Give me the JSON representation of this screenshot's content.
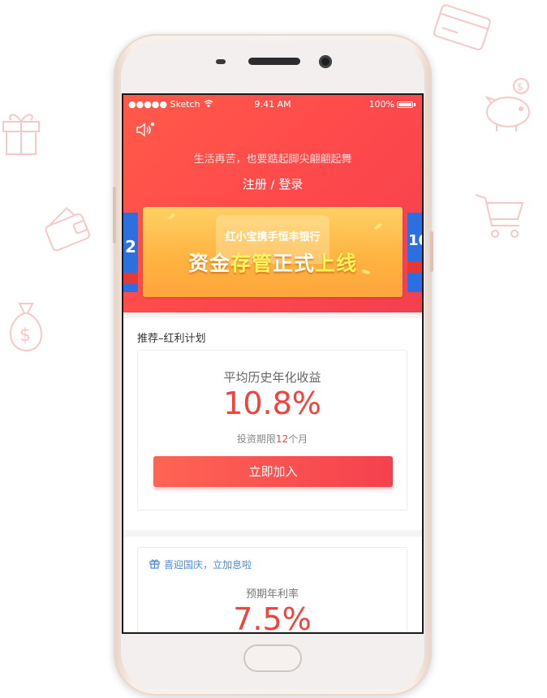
{
  "status_bar": {
    "carrier": "●●●●● Sketch",
    "time": "9:41 AM",
    "battery": "100%"
  },
  "hero": {
    "slogan": "生活再苦，也要踮起脚尖翩翩起舞",
    "login_label": "注册 / 登录"
  },
  "banner": {
    "subtitle": "红小宝携手恒丰银行",
    "title_part1": "资金",
    "title_part2": "存管",
    "title_part3": "正式",
    "title_part4": "上线",
    "left_peek_text": "2",
    "right_peek_text": "10"
  },
  "recommend": {
    "section_title": "推荐–红利计划",
    "avg_label": "平均历史年化收益",
    "rate": "10.8%",
    "term_prefix": "投资期限",
    "term_value": "12",
    "term_suffix": "个月",
    "button_label": "立即加入"
  },
  "promo": {
    "tag_label": "喜迎国庆，立加息啦",
    "expected_label": "预期年利率",
    "rate": "7.5%"
  },
  "colors": {
    "hero": "#ff4b4b",
    "accent": "#f2423e",
    "link_blue": "#4a8bd8",
    "deco_pink": "#f6c9c9"
  },
  "icons": [
    "gift-icon",
    "wallet-icon",
    "money-bag-icon",
    "credit-card-icon",
    "piggy-bank-icon",
    "shopping-cart-icon",
    "speaker-icon",
    "wifi-icon",
    "battery-icon"
  ]
}
